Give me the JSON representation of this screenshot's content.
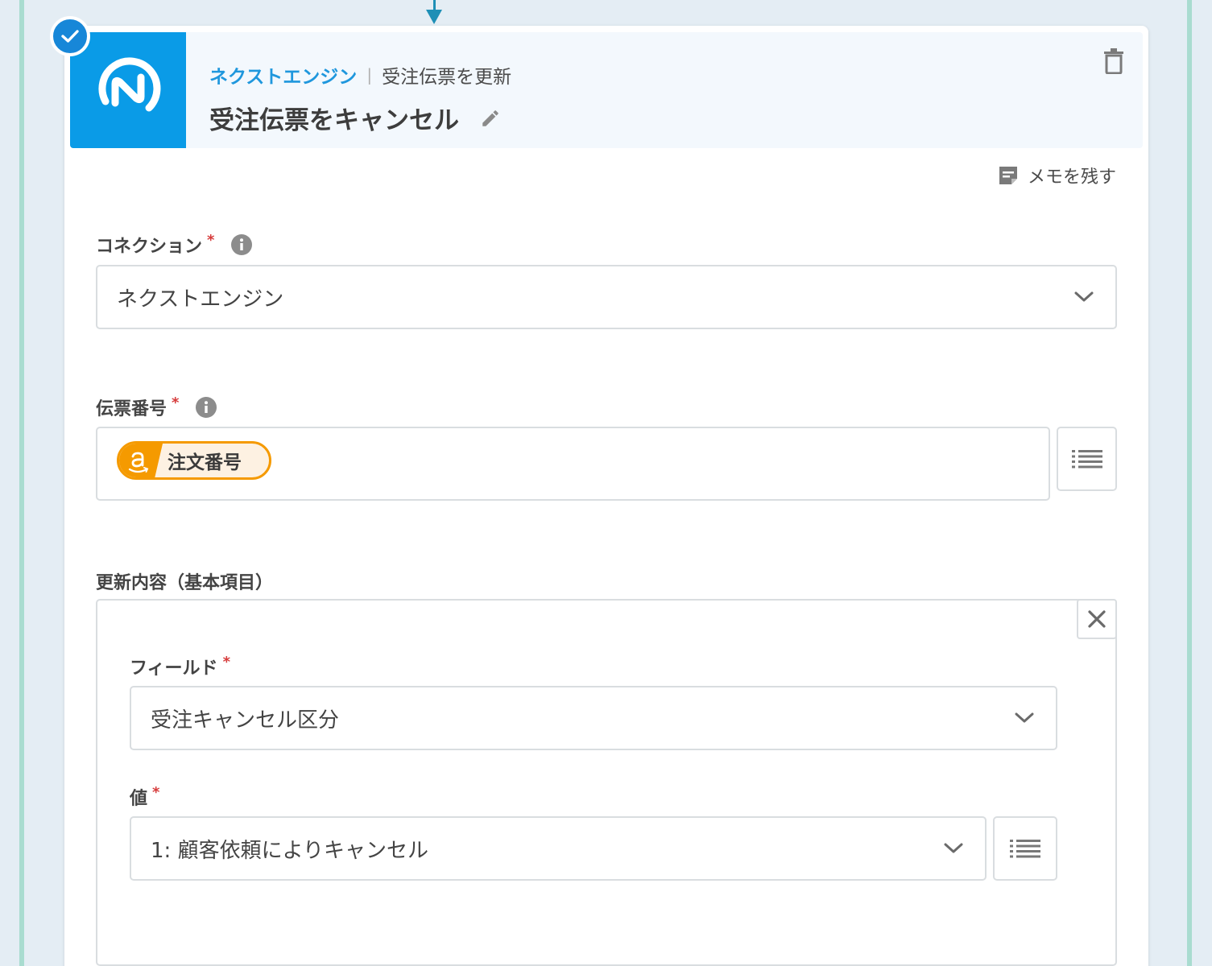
{
  "header": {
    "service_name": "ネクストエンジン",
    "action_name": "受注伝票を更新",
    "title": "受注伝票をキャンセル"
  },
  "memo": {
    "label": "メモを残す"
  },
  "connection": {
    "label": "コネクション",
    "required_mark": "*",
    "value": "ネクストエンジン"
  },
  "slip_number": {
    "label": "伝票番号",
    "required_mark": "*",
    "token_label": "注文番号"
  },
  "update_content": {
    "label": "更新内容（基本項目）",
    "field": {
      "label": "フィールド",
      "required_mark": "*",
      "value": "受注キャンセル区分"
    },
    "value": {
      "label": "値",
      "required_mark": "*",
      "value": "1: 顧客依頼によりキャンセル"
    }
  },
  "colors": {
    "accent": "#1f97dd",
    "logo_bg": "#0a9be7",
    "required": "#d63b3b",
    "amazon_orange": "#f59a00",
    "rail": "#a9dcd0"
  },
  "icons": [
    "check-icon",
    "nextengine-logo",
    "pencil-icon",
    "trash-icon",
    "memo-icon",
    "info-icon",
    "chevron-down-icon",
    "list-icon",
    "amazon-icon",
    "close-icon"
  ]
}
